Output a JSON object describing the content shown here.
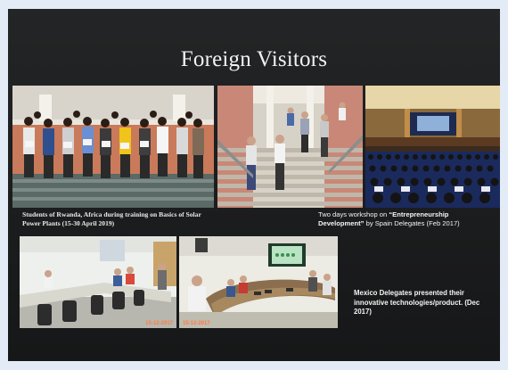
{
  "slide": {
    "title": "Foreign Visitors",
    "captions": {
      "rwanda": "Students of Rwanda, Africa during training on Basics of Solar Power Plants (15-30 April 2019)",
      "spain_prefix": "Two days workshop on ",
      "spain_highlight": "“Entrepreneurship Development”",
      "spain_suffix": " by Spain Delegates (Feb 2017)",
      "mexico": "Mexico Delegates presented their innovative technologies/product. (Dec 2017)"
    },
    "photo_stamps": {
      "mexico_left": "15-12-2017",
      "mexico_right": "15-12-2017"
    }
  },
  "colors": {
    "slide_background": "#1e1f20",
    "page_background": "#e3ecf6",
    "caption_text": "#f4f4f4"
  }
}
